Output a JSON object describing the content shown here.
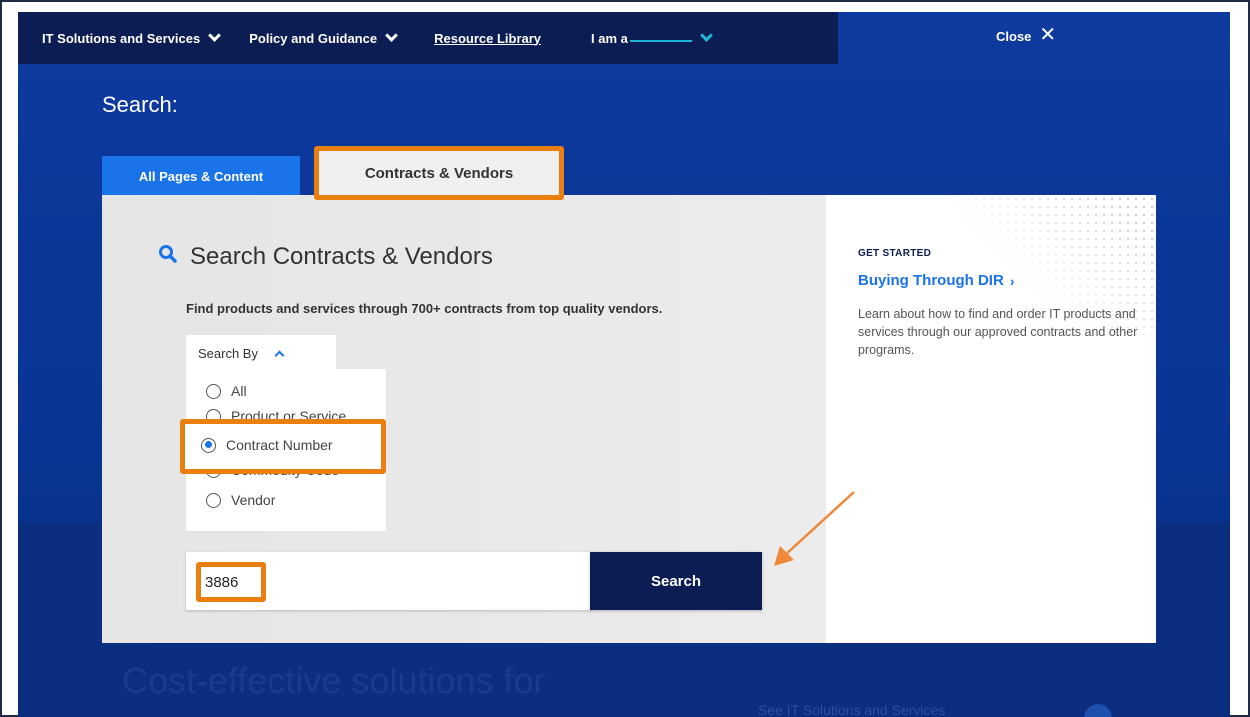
{
  "nav": {
    "items": [
      {
        "label": "IT Solutions and Services"
      },
      {
        "label": "Policy and Guidance"
      },
      {
        "label": "Resource Library"
      },
      {
        "label": "I am a"
      }
    ],
    "close_label": "Close",
    "close_glyph": "✕"
  },
  "search": {
    "heading": "Search:",
    "tabs": [
      {
        "label": "All Pages & Content",
        "active": false
      },
      {
        "label": "Contracts & Vendors",
        "active": true
      }
    ],
    "panel": {
      "title": "Search Contracts & Vendors",
      "title_icon": "search-icon",
      "description": "Find products and services through 700+ contracts from top quality vendors.",
      "search_by_label": "Search By",
      "options": [
        {
          "label": "All",
          "checked": false
        },
        {
          "label": "Product or Service",
          "checked": false
        },
        {
          "label": "Contract Number",
          "checked": true
        },
        {
          "label": "Commodity Code",
          "checked": false
        },
        {
          "label": "Vendor",
          "checked": false
        }
      ],
      "input_value": "3886",
      "button_label": "Search"
    }
  },
  "sidebar": {
    "eyebrow": "GET STARTED",
    "link_label": "Buying Through DIR",
    "link_glyph": "›",
    "body": "Learn about how to find and order IT products and services through our approved contracts and other programs."
  },
  "footer": {
    "headline": "Cost-effective solutions for",
    "link": "See IT Solutions and Services"
  },
  "colors": {
    "highlight": "#e87f0e",
    "accent": "#1a73e8",
    "navy": "#0b1d52",
    "background": "#0f3a9e"
  }
}
